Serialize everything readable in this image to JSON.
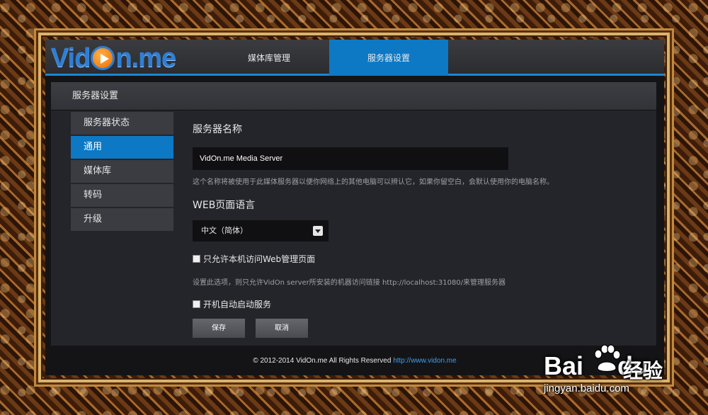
{
  "header": {
    "logo_text_left": "Vid",
    "logo_text_right": "n.me",
    "tabs": [
      {
        "label": "媒体库管理",
        "active": false
      },
      {
        "label": "服务器设置",
        "active": true
      }
    ]
  },
  "panel": {
    "title": "服务器设置",
    "sidebar": [
      {
        "label": "服务器状态",
        "active": false
      },
      {
        "label": "通用",
        "active": true
      },
      {
        "label": "媒体库",
        "active": false
      },
      {
        "label": "转码",
        "active": false
      },
      {
        "label": "升级",
        "active": false
      }
    ],
    "server_name": {
      "title": "服务器名称",
      "value": "VidOn.me Media Server",
      "hint": "这个名称将被使用于此媒体服务器以便你网络上的其他电脑可以辨认它，如果你留空白，会默认使用你的电脑名称。"
    },
    "language": {
      "title": "WEB页面语言",
      "selected": "中文（简体）"
    },
    "local_only": {
      "label": "只允许本机访问Web管理页面",
      "checked": false,
      "hint": "设置此选项，则只允许VidOn server所安装的机器访问链接 http://localhost:31080/来管理服务器"
    },
    "autostart": {
      "label": "开机自动启动服务",
      "checked": false
    },
    "buttons": {
      "save": "保存",
      "cancel": "取消"
    }
  },
  "footer": {
    "copyright": "© 2012-2014 VidOn.me All Rights Reserved",
    "link": "http://www.vidon.me"
  },
  "watermark": {
    "brand_left": "Bai",
    "brand_right": "du",
    "cn": "经验",
    "url": "jingyan.baidu.com"
  },
  "colors": {
    "accent": "#0d79c4",
    "logo_blue": "#2e7fd6",
    "link": "#3ea0f0"
  }
}
